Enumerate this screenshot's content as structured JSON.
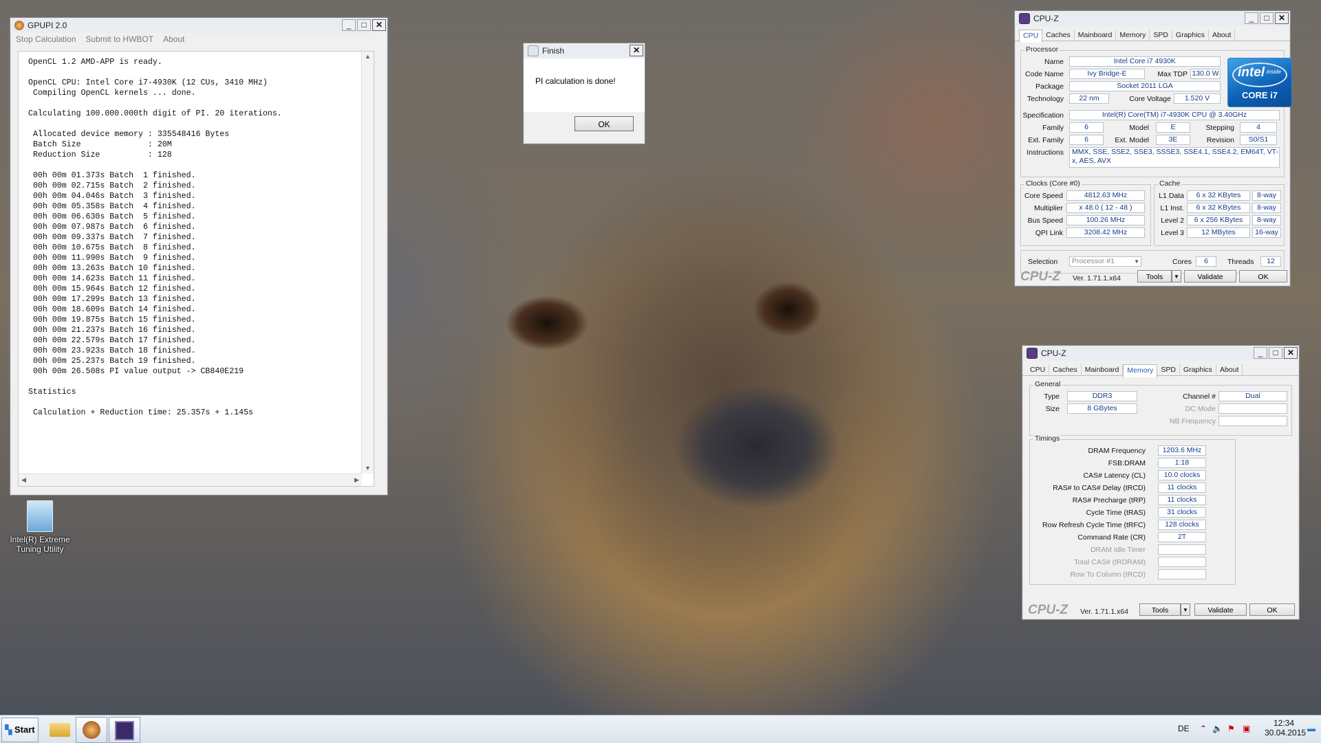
{
  "gpupi": {
    "title": "GPUPI 2.0",
    "menu": [
      "Stop Calculation",
      "Submit to HWBOT",
      "About"
    ],
    "console_lines": [
      "OpenCL 1.2 AMD-APP is ready.",
      "",
      "OpenCL CPU: Intel Core i7-4930K (12 CUs, 3410 MHz)",
      " Compiling OpenCL kernels ... done.",
      "",
      "Calculating 100.000.000th digit of PI. 20 iterations.",
      "",
      " Allocated device memory : 335548416 Bytes",
      " Batch Size              : 20M",
      " Reduction Size          : 128",
      "",
      " 00h 00m 01.373s Batch  1 finished.",
      " 00h 00m 02.715s Batch  2 finished.",
      " 00h 00m 04.046s Batch  3 finished.",
      " 00h 00m 05.358s Batch  4 finished.",
      " 00h 00m 06.630s Batch  5 finished.",
      " 00h 00m 07.987s Batch  6 finished.",
      " 00h 00m 09.337s Batch  7 finished.",
      " 00h 00m 10.675s Batch  8 finished.",
      " 00h 00m 11.990s Batch  9 finished.",
      " 00h 00m 13.263s Batch 10 finished.",
      " 00h 00m 14.623s Batch 11 finished.",
      " 00h 00m 15.964s Batch 12 finished.",
      " 00h 00m 17.299s Batch 13 finished.",
      " 00h 00m 18.609s Batch 14 finished.",
      " 00h 00m 19.875s Batch 15 finished.",
      " 00h 00m 21.237s Batch 16 finished.",
      " 00h 00m 22.579s Batch 17 finished.",
      " 00h 00m 23.923s Batch 18 finished.",
      " 00h 00m 25.237s Batch 19 finished.",
      " 00h 00m 26.508s PI value output -> CB840E219",
      "",
      "Statistics",
      "",
      " Calculation + Reduction time: 25.357s + 1.145s"
    ]
  },
  "finish": {
    "title": "Finish",
    "message": "PI calculation is done!",
    "ok": "OK"
  },
  "cpuz_cpu": {
    "title": "CPU-Z",
    "tabs": [
      "CPU",
      "Caches",
      "Mainboard",
      "Memory",
      "SPD",
      "Graphics",
      "About"
    ],
    "processor_group": "Processor",
    "name_label": "Name",
    "name": "Intel Core i7 4930K",
    "codename_label": "Code Name",
    "codename": "Ivy Bridge-E",
    "maxtdp_label": "Max TDP",
    "maxtdp": "130.0 W",
    "package_label": "Package",
    "package": "Socket 2011 LGA",
    "technology_label": "Technology",
    "technology": "22 nm",
    "corevoltage_label": "Core Voltage",
    "corevoltage": "1.520 V",
    "spec_label": "Specification",
    "spec": "Intel(R) Core(TM) i7-4930K CPU @ 3.40GHz",
    "family_label": "Family",
    "family": "6",
    "model_label": "Model",
    "model": "E",
    "stepping_label": "Stepping",
    "stepping": "4",
    "extfamily_label": "Ext. Family",
    "extfamily": "6",
    "extmodel_label": "Ext. Model",
    "extmodel": "3E",
    "revision_label": "Revision",
    "revision": "S0/S1",
    "instructions_label": "Instructions",
    "instructions": "MMX, SSE, SSE2, SSE3, SSSE3, SSE4.1, SSE4.2, EM64T, VT-x, AES, AVX",
    "clocks_group": "Clocks (Core #0)",
    "corespeed_label": "Core Speed",
    "corespeed": "4812.63 MHz",
    "multiplier_label": "Multiplier",
    "multiplier": "x 48.0 ( 12 - 48 )",
    "busspeed_label": "Bus Speed",
    "busspeed": "100.26 MHz",
    "qpilink_label": "QPI Link",
    "qpilink": "3208.42 MHz",
    "cache_group": "Cache",
    "l1d_label": "L1 Data",
    "l1d": "6 x 32 KBytes",
    "l1d_way": "8-way",
    "l1i_label": "L1 Inst.",
    "l1i": "6 x 32 KBytes",
    "l1i_way": "8-way",
    "l2_label": "Level 2",
    "l2": "6 x 256 KBytes",
    "l2_way": "8-way",
    "l3_label": "Level 3",
    "l3": "12 MBytes",
    "l3_way": "16-way",
    "selection_label": "Selection",
    "selection": "Processor #1",
    "cores_label": "Cores",
    "cores": "6",
    "threads_label": "Threads",
    "threads": "12",
    "brand": "CPU-Z",
    "version": "Ver. 1.71.1.x64",
    "tools": "Tools",
    "validate": "Validate",
    "ok": "OK",
    "logo": {
      "word": "intel",
      "inside": "inside",
      "line": "CORE i7"
    }
  },
  "cpuz_mem": {
    "title": "CPU-Z",
    "tabs": [
      "CPU",
      "Caches",
      "Mainboard",
      "Memory",
      "SPD",
      "Graphics",
      "About"
    ],
    "general_group": "General",
    "type_label": "Type",
    "type": "DDR3",
    "size_label": "Size",
    "size": "8 GBytes",
    "channel_label": "Channel #",
    "channel": "Dual",
    "dcmode_label": "DC Mode",
    "dcmode": "",
    "nbfreq_label": "NB Frequency",
    "nbfreq": "",
    "timings_group": "Timings",
    "timings": [
      {
        "label": "DRAM Frequency",
        "value": "1203.6 MHz",
        "disabled": false
      },
      {
        "label": "FSB:DRAM",
        "value": "1:18",
        "disabled": false
      },
      {
        "label": "CAS# Latency (CL)",
        "value": "10.0 clocks",
        "disabled": false
      },
      {
        "label": "RAS# to CAS# Delay (tRCD)",
        "value": "11 clocks",
        "disabled": false
      },
      {
        "label": "RAS# Precharge (tRP)",
        "value": "11 clocks",
        "disabled": false
      },
      {
        "label": "Cycle Time (tRAS)",
        "value": "31 clocks",
        "disabled": false
      },
      {
        "label": "Row Refresh Cycle Time (tRFC)",
        "value": "128 clocks",
        "disabled": false
      },
      {
        "label": "Command Rate (CR)",
        "value": "2T",
        "disabled": false
      },
      {
        "label": "DRAM Idle Timer",
        "value": "",
        "disabled": true
      },
      {
        "label": "Total CAS# (tRDRAM)",
        "value": "",
        "disabled": true
      },
      {
        "label": "Row To Column (tRCD)",
        "value": "",
        "disabled": true
      }
    ],
    "brand": "CPU-Z",
    "version": "Ver. 1.71.1.x64",
    "tools": "Tools",
    "validate": "Validate",
    "ok": "OK"
  },
  "desktop_icon": {
    "label": "Intel(R) Extreme Tuning Utility"
  },
  "taskbar": {
    "start": "Start",
    "language": "DE",
    "time": "12:34",
    "date": "30.04.2015"
  },
  "colors": {
    "value_text": "#143c8a",
    "active_tab": "#2a5db0",
    "intel_blue": "#0b5fb4"
  }
}
